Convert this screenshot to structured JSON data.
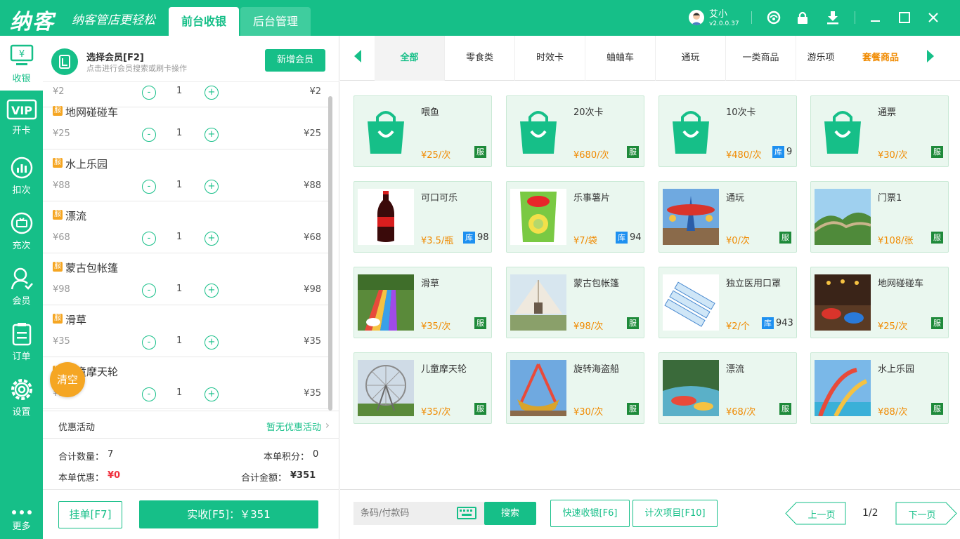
{
  "header": {
    "logo": "纳客",
    "slogan": "纳客管店更轻松",
    "tabs": [
      {
        "label": "前台收银"
      },
      {
        "label": "后台管理"
      }
    ],
    "user": {
      "name": "艾小",
      "version": "v2.0.0.37"
    }
  },
  "sidebar": {
    "items": [
      {
        "label": "收银"
      },
      {
        "label": "开卡",
        "badge": "VIP"
      },
      {
        "label": "扣次"
      },
      {
        "label": "充次"
      },
      {
        "label": "会员"
      },
      {
        "label": "订单"
      },
      {
        "label": "设置"
      },
      {
        "label": "更多"
      }
    ]
  },
  "member": {
    "title": "选择会员[F2]",
    "subtitle": "点击进行会员搜索或刷卡操作",
    "add_button": "新增会员"
  },
  "cart": {
    "badge": "服",
    "partial_top": {
      "price": "¥2",
      "qty": "1",
      "subtotal": "¥2"
    },
    "items": [
      {
        "name": "地网碰碰车",
        "price": "¥25",
        "qty": "1",
        "subtotal": "¥25"
      },
      {
        "name": "水上乐园",
        "price": "¥88",
        "qty": "1",
        "subtotal": "¥88"
      },
      {
        "name": "漂流",
        "price": "¥68",
        "qty": "1",
        "subtotal": "¥68"
      },
      {
        "name": "蒙古包帐篷",
        "price": "¥98",
        "qty": "1",
        "subtotal": "¥98"
      },
      {
        "name": "滑草",
        "price": "¥35",
        "qty": "1",
        "subtotal": "¥35"
      },
      {
        "name": "儿童摩天轮",
        "price": "¥35",
        "qty": "1",
        "subtotal": "¥35"
      }
    ],
    "minus": "-",
    "plus": "+",
    "clear_button": "清空"
  },
  "promo": {
    "label": "优惠活动",
    "value": "暂无优惠活动"
  },
  "summary": {
    "qty_label": "合计数量：",
    "qty_value": "7",
    "points_label": "本单积分：",
    "points_value": "0",
    "discount_label": "本单优惠：",
    "discount_value": "¥0",
    "total_label": "合计金额：",
    "total_value": "¥351"
  },
  "actions": {
    "hold": "挂单[F7]",
    "pay": "实收[F5]：￥351"
  },
  "categories": [
    {
      "label": "全部"
    },
    {
      "label": "零食类"
    },
    {
      "label": "时效卡"
    },
    {
      "label": "蛐蛐车"
    },
    {
      "label": "通玩"
    },
    {
      "label": "一类商品"
    },
    {
      "label": "游乐项"
    },
    {
      "label": "套餐商品"
    }
  ],
  "products": [
    {
      "name": "喂鱼",
      "price": "¥25/次",
      "tag": "服",
      "icon": "shopping-bag-icon"
    },
    {
      "name": "20次卡",
      "price": "¥680/次",
      "tag": "服",
      "icon": "shopping-bag-icon"
    },
    {
      "name": "10次卡",
      "price": "¥480/次",
      "tag": "库",
      "stock": "9",
      "icon": "shopping-bag-icon"
    },
    {
      "name": "通票",
      "price": "¥30/次",
      "tag": "服",
      "icon": "shopping-bag-icon"
    },
    {
      "name": "可口可乐",
      "price": "¥3.5/瓶",
      "tag": "库",
      "stock": "98",
      "icon": "cola-bottle-icon"
    },
    {
      "name": "乐事薯片",
      "price": "¥7/袋",
      "tag": "库",
      "stock": "94",
      "icon": "chips-bag-icon"
    },
    {
      "name": "通玩",
      "price": "¥0/次",
      "tag": "服",
      "icon": "ride-photo-icon"
    },
    {
      "name": "门票1",
      "price": "¥108/张",
      "tag": "服",
      "icon": "great-wall-photo-icon"
    },
    {
      "name": "滑草",
      "price": "¥35/次",
      "tag": "服",
      "icon": "grass-slide-photo-icon"
    },
    {
      "name": "蒙古包帐篷",
      "price": "¥98/次",
      "tag": "服",
      "icon": "tent-photo-icon"
    },
    {
      "name": "独立医用口罩",
      "price": "¥2/个",
      "tag": "库",
      "stock": "943",
      "icon": "mask-photo-icon"
    },
    {
      "name": "地网碰碰车",
      "price": "¥25/次",
      "tag": "服",
      "icon": "bumper-car-photo-icon"
    },
    {
      "name": "儿童摩天轮",
      "price": "¥35/次",
      "tag": "服",
      "icon": "ferris-wheel-photo-icon"
    },
    {
      "name": "旋转海盗船",
      "price": "¥30/次",
      "tag": "服",
      "icon": "pirate-ship-photo-icon"
    },
    {
      "name": "漂流",
      "price": "¥68/次",
      "tag": "服",
      "icon": "rafting-photo-icon"
    },
    {
      "name": "水上乐园",
      "price": "¥88/次",
      "tag": "服",
      "icon": "water-park-photo-icon"
    }
  ],
  "footer": {
    "search_placeholder": "条码/付款码",
    "search_button": "搜索",
    "quick_button": "快速收银[F6]",
    "count_button": "计次项目[F10]",
    "prev_button": "上一页",
    "page": "1/2",
    "next_button": "下一页"
  },
  "colors": {
    "brand": "#16bf88",
    "price": "#f08a00",
    "discount": "#f0303e",
    "clear": "#f5a623"
  }
}
